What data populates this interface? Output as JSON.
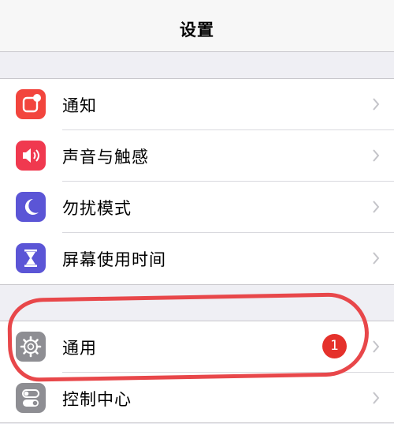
{
  "nav": {
    "title": "设置"
  },
  "group1": [
    {
      "label": "通知",
      "icon": "notifications-icon",
      "color": "#f2453d"
    },
    {
      "label": "声音与触感",
      "icon": "speaker-icon",
      "color": "#f0394f"
    },
    {
      "label": "勿扰模式",
      "icon": "moon-icon",
      "color": "#5b55d6"
    },
    {
      "label": "屏幕使用时间",
      "icon": "hourglass-icon",
      "color": "#5b55d6"
    }
  ],
  "group2": [
    {
      "label": "通用",
      "icon": "gear-icon",
      "color": "#8e8e93",
      "badge": "1"
    },
    {
      "label": "控制中心",
      "icon": "toggles-icon",
      "color": "#8e8e93"
    }
  ],
  "annotation": {
    "color": "#e8474a"
  }
}
